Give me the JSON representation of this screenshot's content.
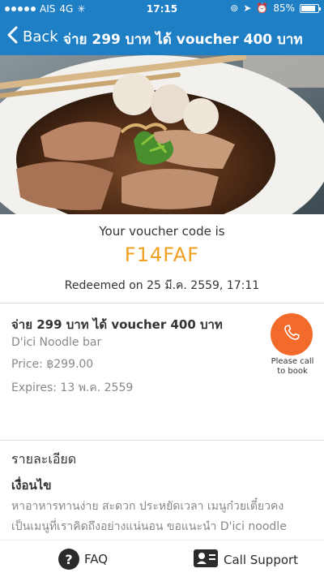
{
  "status_bar": {
    "carrier": "AIS",
    "network": "4G",
    "time": "17:15",
    "battery": "85%",
    "battery_level": 0.85
  },
  "nav": {
    "back_label": "Back",
    "title": "จ่าย 299 บาท ได้ voucher 400 บาท"
  },
  "voucher": {
    "code_label": "Your voucher code is",
    "code": "F14FAF",
    "redeemed": "Redeemed on 25 มี.ค. 2559, 17:11"
  },
  "deal": {
    "title": "จ่าย 299 บาท ได้ voucher 400 บาท",
    "merchant": "D'ici Noodle bar",
    "price": "Price: ฿299.00",
    "expires": "Expires: 13 พ.ค. 2559",
    "call_label": "Please call to book"
  },
  "details": {
    "section_title": "รายละเอียด",
    "conditions_title": "เงื่อนไข",
    "lines": [
      "หาอาหารทานง่าย สะดวก ประหยัดเวลา เมนูก๋วยเตี๋ยวคง",
      "เป็นเมนูที่เราคิดถึงอย่างแน่นอน ขอแนะนำ D'ici noodle"
    ]
  },
  "bottom": {
    "faq_label": "FAQ",
    "support_label": "Call Support"
  },
  "colors": {
    "header_blue": "#1f7fc4",
    "code_orange": "#f2a01f",
    "call_orange": "#f36b2b"
  },
  "icons": {
    "back": "chevron-left-icon",
    "call": "phone-icon",
    "faq": "question-icon",
    "support": "contact-card-icon"
  }
}
